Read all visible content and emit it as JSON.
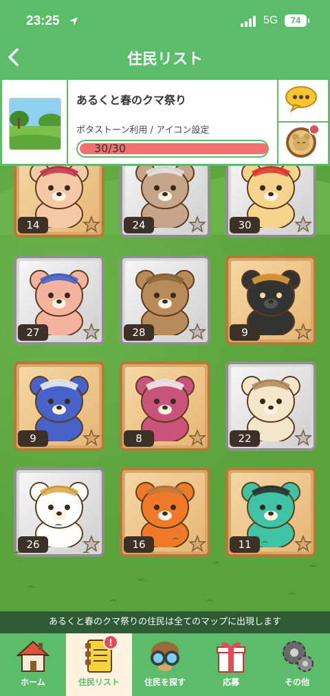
{
  "status": {
    "time": "23:25",
    "network": "5G",
    "battery": "74"
  },
  "header": {
    "title": "住民リスト"
  },
  "event": {
    "name": "あるくと春のクマ祭り",
    "subtitle": "ポタストーン利用 / アイコン設定",
    "stamina": "30/30",
    "stamina_fraction": 1.0
  },
  "residents": [
    {
      "number": "14",
      "frame": "bronze",
      "fur": "#f5c9a6",
      "accent": "#c0304a"
    },
    {
      "number": "24",
      "frame": "silver",
      "fur": "#c6a58a",
      "accent": "#e8e8e8"
    },
    {
      "number": "30",
      "frame": "silver",
      "fur": "#f5d38a",
      "accent": "#e03030"
    },
    {
      "number": "27",
      "frame": "silver",
      "fur": "#f4b39e",
      "accent": "#3b5fc9"
    },
    {
      "number": "28",
      "frame": "silver",
      "fur": "#b98a5a",
      "accent": "#8a6a3a"
    },
    {
      "number": "9",
      "frame": "bronze",
      "fur": "#333333",
      "accent": "#e7a23a"
    },
    {
      "number": "9",
      "frame": "bronze",
      "fur": "#4763c9",
      "accent": "#f4f4f4"
    },
    {
      "number": "8",
      "frame": "bronze",
      "fur": "#c9537a",
      "accent": "#f4f4f4"
    },
    {
      "number": "22",
      "frame": "silver",
      "fur": "#f3e6cb",
      "accent": "#b08a5a"
    },
    {
      "number": "26",
      "frame": "silver",
      "fur": "#ffffff",
      "accent": "#d9a640"
    },
    {
      "number": "16",
      "frame": "bronze",
      "fur": "#f07a2a",
      "accent": "#c37a3a"
    },
    {
      "number": "11",
      "frame": "bronze",
      "fur": "#3fc3a4",
      "accent": "#2b2b2b"
    }
  ],
  "banner": "あるくと春のクマ祭りの住民は全てのマップに出現します",
  "tabs": [
    {
      "label": "ホーム",
      "icon": "house-icon"
    },
    {
      "label": "住民リスト",
      "icon": "notebook-icon",
      "badge": "!"
    },
    {
      "label": "住民を探す",
      "icon": "binoculars-icon"
    },
    {
      "label": "応募",
      "icon": "gift-icon"
    },
    {
      "label": "その他",
      "icon": "gear-icon"
    }
  ],
  "colors": {
    "brand_green": "#5bbd6a",
    "accent_red": "#e44b52",
    "bar_fill": "#f07070"
  }
}
